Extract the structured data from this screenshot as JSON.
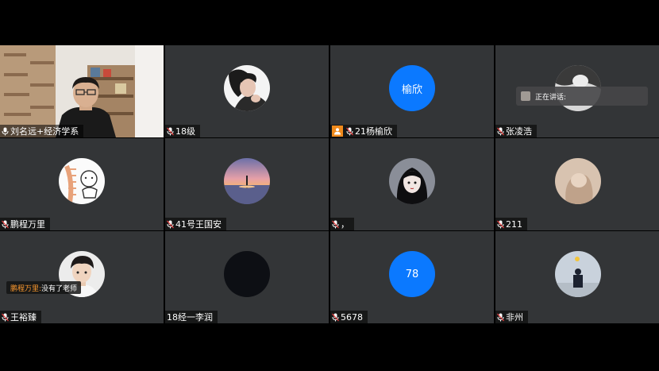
{
  "colors": {
    "tile_bg": "#333537",
    "text_avatar_bg": "#0b79ff",
    "host_badge": "#f08a1c",
    "chat_sender": "#ff9a2e"
  },
  "tiles": [
    {
      "name": "刘名远+经济学系",
      "icon": "mic-icon",
      "type": "video"
    },
    {
      "name": "18级",
      "icon": "mic-muted-icon",
      "type": "photo"
    },
    {
      "name": "21杨榆欣",
      "icon": "mic-muted-icon",
      "badge": "host-badge-icon",
      "type": "text-avatar",
      "avatar_text": "榆欣"
    },
    {
      "name": "张凌浩",
      "icon": "mic-muted-icon",
      "type": "photo"
    },
    {
      "name": "鹏程万里",
      "icon": "mic-muted-icon",
      "type": "photo"
    },
    {
      "name": "41号王国安",
      "icon": "mic-muted-icon",
      "type": "photo"
    },
    {
      "name": "，",
      "icon": "mic-muted-icon",
      "type": "photo"
    },
    {
      "name": "211",
      "icon": "mic-muted-icon",
      "type": "photo"
    },
    {
      "name": "王裕臻",
      "icon": "mic-muted-icon",
      "type": "photo"
    },
    {
      "name": "18经一李润",
      "icon": "",
      "type": "photo"
    },
    {
      "name": "5678",
      "icon": "mic-muted-icon",
      "type": "text-avatar",
      "avatar_text": "78"
    },
    {
      "name": "非州",
      "icon": "mic-muted-icon",
      "type": "photo"
    }
  ],
  "speaking": {
    "label": "正在讲话:"
  },
  "chat": {
    "sender": "鹏程万里:",
    "message": "没有了老师"
  }
}
